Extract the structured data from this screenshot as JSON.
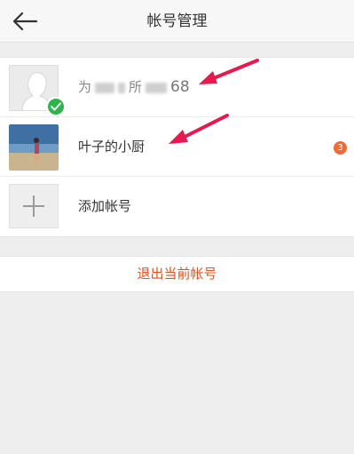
{
  "header": {
    "title": "帐号管理",
    "back_icon": "arrow-left-icon"
  },
  "accounts": [
    {
      "name_prefix": "为",
      "name_mid": "所",
      "name_suffix": "68",
      "avatar": "blank-person-avatar",
      "active": true,
      "check_icon": "check-icon"
    },
    {
      "name": "叶子的小厨",
      "avatar": "beach-photo-avatar",
      "badge": "3"
    }
  ],
  "add_account": {
    "label": "添加帐号",
    "icon": "plus-icon"
  },
  "logout": {
    "label": "退出当前帐号"
  },
  "colors": {
    "accent": "#e0531f",
    "badge": "#f06a35",
    "check": "#2fb34a",
    "arrow": "#e8194f"
  }
}
